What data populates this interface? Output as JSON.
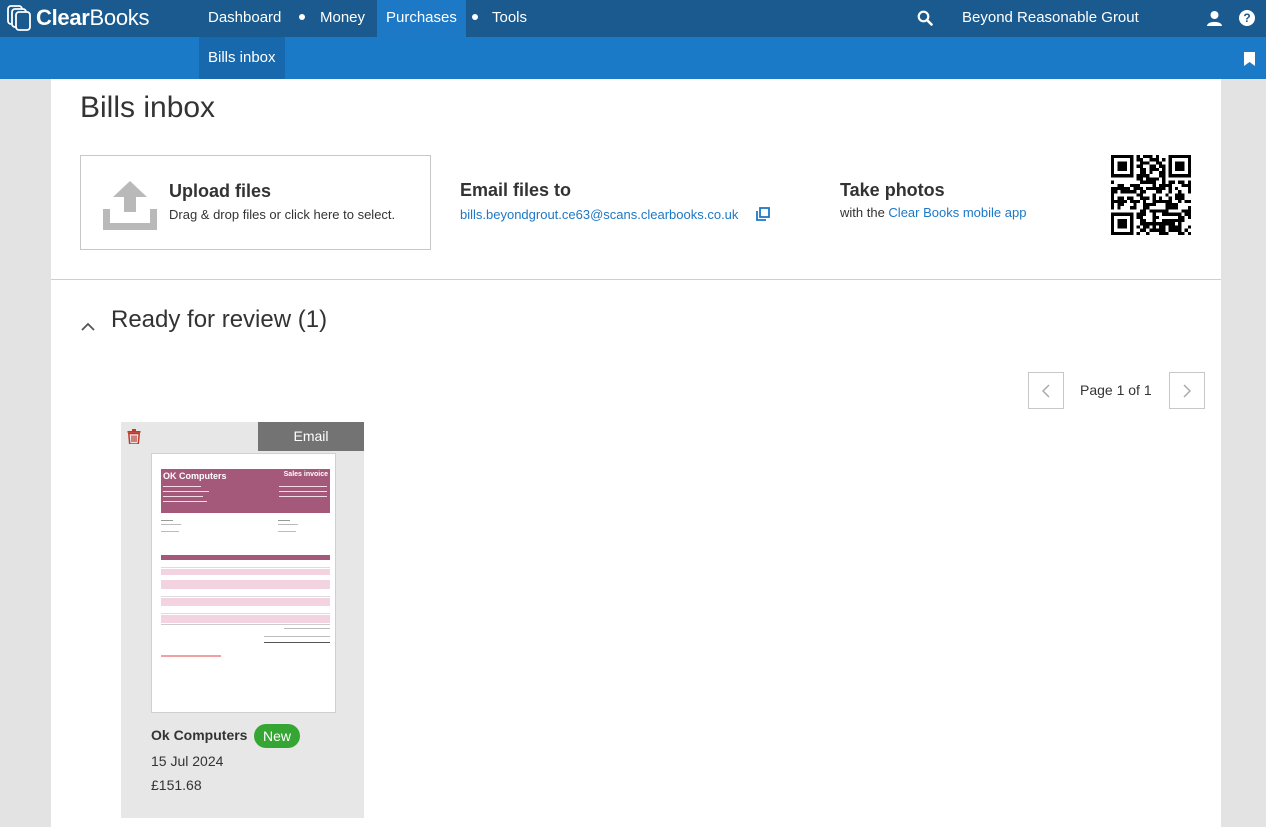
{
  "app": {
    "logo_text_bold": "Clear",
    "logo_text_rest": "Books",
    "company_name": "Beyond Reasonable Grout",
    "brand_color": "#1a5a8e",
    "accent_color": "#1d78c6"
  },
  "nav": {
    "items": [
      {
        "label": "Dashboard",
        "active": false
      },
      {
        "label": "Money",
        "active": false
      },
      {
        "label": "Purchases",
        "active": true
      },
      {
        "label": "Tools",
        "active": false
      }
    ],
    "icons": [
      "search-icon",
      "user-icon",
      "help-icon"
    ],
    "help_glyph": "?"
  },
  "subnav": {
    "items": [
      {
        "label": "Bills inbox",
        "active": true
      }
    ],
    "icons": [
      "bookmark-icon"
    ]
  },
  "page": {
    "title": "Bills inbox"
  },
  "upload": {
    "title": "Upload files",
    "subtitle": "Drag & drop files or click here to select.",
    "icon": "upload-icon"
  },
  "email": {
    "title": "Email files to",
    "address": "bills.beyondgrout.ce63@scans.clearbooks.co.uk",
    "icon": "copy-icon"
  },
  "photos": {
    "title": "Take photos",
    "prefix": "with the ",
    "link": "Clear Books mobile app",
    "icon": "qr-code"
  },
  "review": {
    "title": "Ready for review (1)",
    "icon": "chevron-up-icon"
  },
  "pagination": {
    "text": "Page 1 of 1",
    "icons": [
      "chevron-left-icon",
      "chevron-right-icon"
    ]
  },
  "bills": [
    {
      "source": "Email",
      "supplier": "Ok Computers",
      "badge": "New",
      "badge_color": "#35a634",
      "date": "15 Jul 2024",
      "amount": "£151.68",
      "thumbnail": {
        "company": "OK Computers",
        "doc_type": "Sales invoice",
        "accent": "#a4587a"
      },
      "icons": [
        "trash-icon"
      ]
    }
  ]
}
